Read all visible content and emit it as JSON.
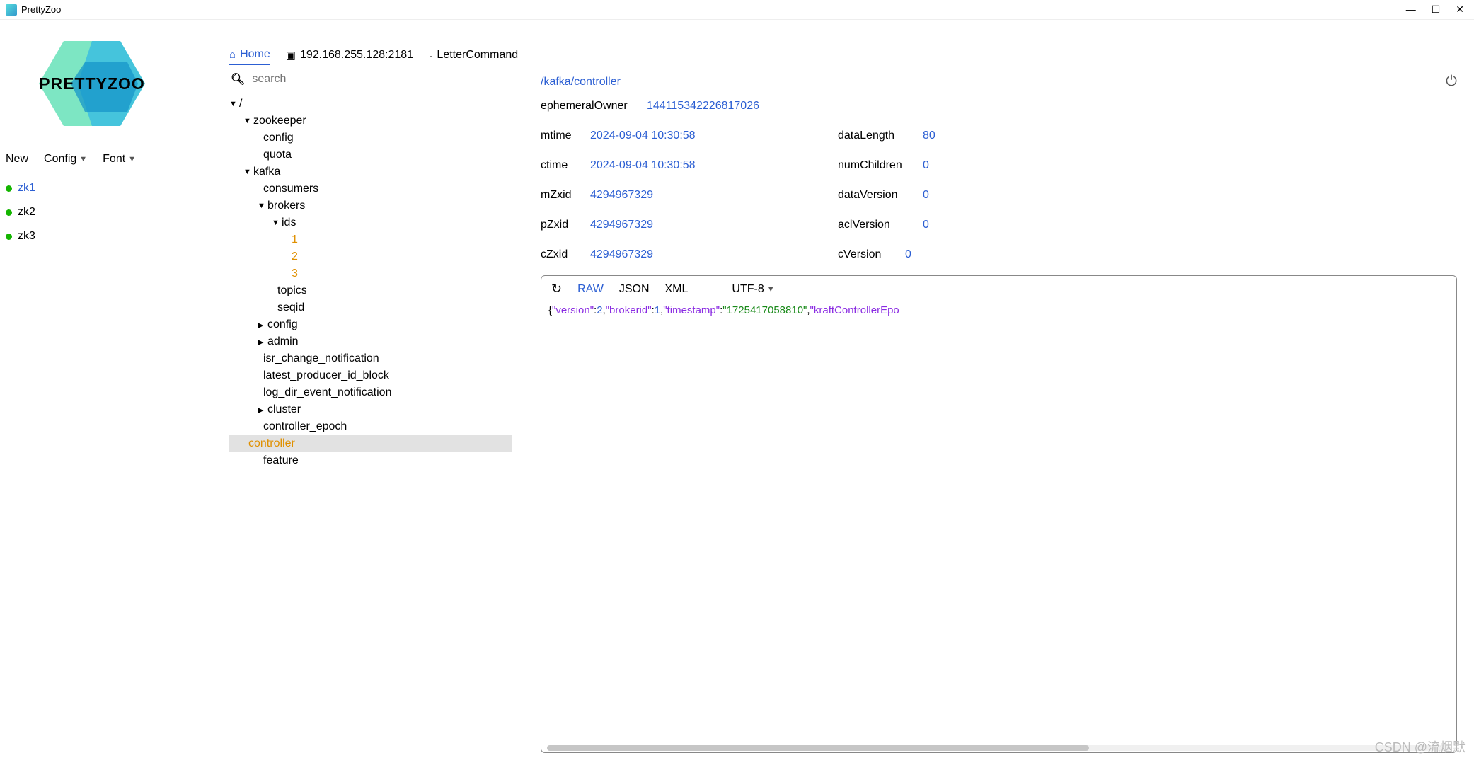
{
  "window": {
    "title": "PrettyZoo"
  },
  "logo": {
    "text": "PRETTYZOO"
  },
  "sidebarMenu": {
    "new": "New",
    "config": "Config",
    "font": "Font"
  },
  "servers": [
    {
      "name": "zk1",
      "active": true
    },
    {
      "name": "zk2",
      "active": false
    },
    {
      "name": "zk3",
      "active": false
    }
  ],
  "tabs": {
    "home": "Home",
    "terminal": "192.168.255.128:2181",
    "letter": "LetterCommand"
  },
  "search": {
    "placeholder": "search"
  },
  "tree": {
    "root": "/",
    "zookeeper": "zookeeper",
    "zk_config": "config",
    "zk_quota": "quota",
    "kafka": "kafka",
    "consumers": "consumers",
    "brokers": "brokers",
    "ids": "ids",
    "id1": "1",
    "id2": "2",
    "id3": "3",
    "topics": "topics",
    "seqid": "seqid",
    "config": "config",
    "admin": "admin",
    "isr": "isr_change_notification",
    "lpib": "latest_producer_id_block",
    "lden": "log_dir_event_notification",
    "cluster": "cluster",
    "ctrl_epoch": "controller_epoch",
    "controller": "controller",
    "feature": "feature"
  },
  "detail": {
    "path": "/kafka/controller",
    "stats": {
      "ephemeralOwner_l": "ephemeralOwner",
      "ephemeralOwner_v": "144115342226817026",
      "mtime_l": "mtime",
      "mtime_v": "2024-09-04 10:30:58",
      "dataLength_l": "dataLength",
      "dataLength_v": "80",
      "ctime_l": "ctime",
      "ctime_v": "2024-09-04 10:30:58",
      "numChildren_l": "numChildren",
      "numChildren_v": "0",
      "mZxid_l": "mZxid",
      "mZxid_v": "4294967329",
      "dataVersion_l": "dataVersion",
      "dataVersion_v": "0",
      "pZxid_l": "pZxid",
      "pZxid_v": "4294967329",
      "aclVersion_l": "aclVersion",
      "aclVersion_v": "0",
      "cZxid_l": "cZxid",
      "cZxid_v": "4294967329",
      "cVersion_l": "cVersion",
      "cVersion_v": "0"
    },
    "formats": {
      "raw": "RAW",
      "json": "JSON",
      "xml": "XML"
    },
    "encoding": "UTF-8",
    "data": {
      "k_version": "\"version\"",
      "v_version": "2",
      "k_brokerid": "\"brokerid\"",
      "v_brokerid": "1",
      "k_timestamp": "\"timestamp\"",
      "v_timestamp": "\"1725417058810\"",
      "k_kraft": "\"kraftControllerEpo"
    }
  },
  "watermark": "CSDN @流烟默"
}
